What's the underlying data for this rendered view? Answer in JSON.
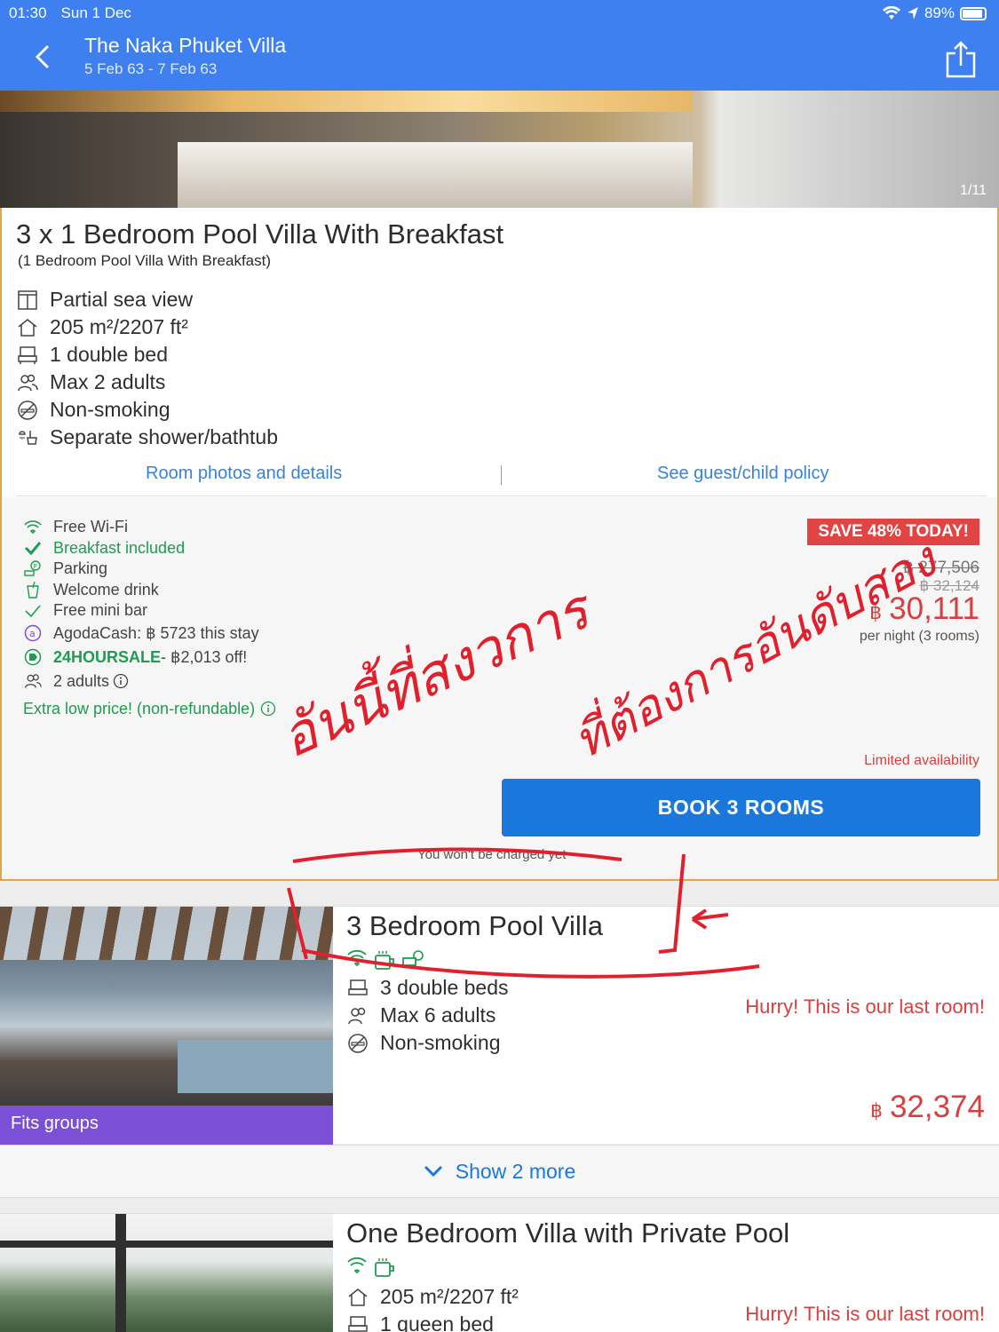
{
  "status_bar": {
    "time": "01:30",
    "date": "Sun 1 Dec",
    "battery": "89%"
  },
  "header": {
    "title": "The Naka Phuket Villa",
    "dates": "5 Feb 63 - 7 Feb 63"
  },
  "gallery": {
    "counter": "1/11"
  },
  "room1": {
    "title": "3 x 1 Bedroom Pool Villa With Breakfast",
    "subtitle": "(1 Bedroom Pool Villa With Breakfast)",
    "features": [
      {
        "icon": "window-view-icon",
        "label": "Partial sea view"
      },
      {
        "icon": "house-size-icon",
        "label": "205 m²/2207 ft²"
      },
      {
        "icon": "bed-icon",
        "label": "1 double bed"
      },
      {
        "icon": "people-icon",
        "label": "Max 2 adults"
      },
      {
        "icon": "no-smoking-icon",
        "label": "Non-smoking"
      },
      {
        "icon": "shower-icon",
        "label": "Separate shower/bathtub"
      }
    ],
    "links": {
      "photos": "Room photos and details",
      "policy": "See guest/child policy"
    },
    "amenities": {
      "wifi": "Free Wi-Fi",
      "breakfast": "Breakfast included",
      "parking": "Parking",
      "welcome_drink": "Welcome drink",
      "minibar": "Free mini bar",
      "agodacash": "AgodaCash: ฿ 5723 this stay",
      "promo_code": "24HOURSALE",
      "promo_text": " - ฿2,013 off!",
      "adults": "2 adults",
      "extra": "Extra low price! (non-refundable)"
    },
    "pricing": {
      "save_badge": "SAVE 48% TODAY!",
      "old_price_1": "฿ 277,506",
      "old_price_2": "฿ 32,124",
      "currency": "฿",
      "price": "30,111",
      "per_night": "per night (3 rooms)",
      "availability": "Limited availability",
      "book_label": "BOOK 3 ROOMS",
      "not_charged": "You won't be charged yet"
    }
  },
  "room2": {
    "title": "3 Bedroom Pool Villa",
    "badge": "Fits groups",
    "features": [
      {
        "icon": "bed-icon",
        "label": "3 double beds"
      },
      {
        "icon": "people-icon",
        "label": "Max 6 adults"
      },
      {
        "icon": "no-smoking-icon",
        "label": "Non-smoking"
      }
    ],
    "hurry": "Hurry! This is our last room!",
    "currency": "฿",
    "price": "32,374"
  },
  "show_more": {
    "label": "Show 2 more"
  },
  "room3": {
    "title": "One Bedroom Villa with Private Pool",
    "features": [
      {
        "icon": "house-size-icon",
        "label": "205 m²/2207 ft²"
      },
      {
        "icon": "bed-icon",
        "label": "1 queen bed"
      }
    ],
    "hurry": "Hurry! This is our last room!"
  },
  "annotation": {
    "line1": "อันนี้ที่สงวการ",
    "line2": "ที่ต้องการอันดับสอง"
  },
  "colors": {
    "header_bg": "#3e80f0",
    "book_button": "#1a78dd",
    "price_red": "#d83f3f",
    "green": "#1e9c52",
    "fits_groups": "#7b4fd6",
    "annotation_red": "#e0202c"
  }
}
